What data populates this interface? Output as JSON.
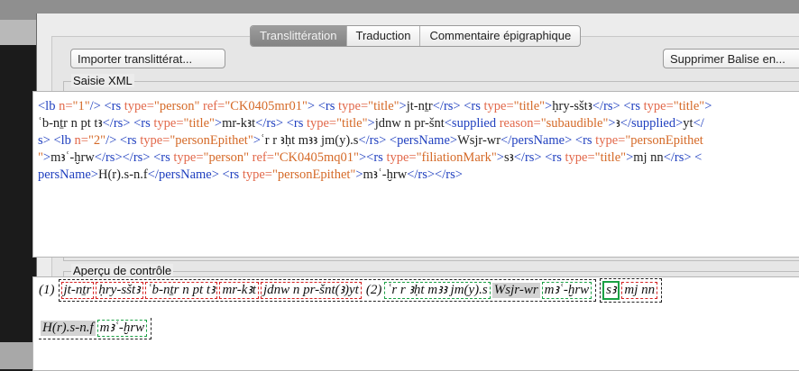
{
  "tabs": [
    {
      "label": "Translittération",
      "active": true
    },
    {
      "label": "Traduction",
      "active": false
    },
    {
      "label": "Commentaire épigraphique",
      "active": false
    }
  ],
  "toolbar": {
    "import_label": "Importer translittérat...",
    "remove_label": "Supprimer Balise en..."
  },
  "xml_group": {
    "label": "Saisie XML"
  },
  "xml_lines": [
    [
      {
        "c": "t",
        "s": "<lb "
      },
      {
        "c": "a",
        "s": "n="
      },
      {
        "c": "v",
        "s": "\"1\""
      },
      {
        "c": "t",
        "s": "/> "
      },
      {
        "c": "t",
        "s": "<rs "
      },
      {
        "c": "a",
        "s": "type="
      },
      {
        "c": "v",
        "s": "\"person\" "
      },
      {
        "c": "a",
        "s": "ref="
      },
      {
        "c": "v",
        "s": "\"CK0405mr01\""
      },
      {
        "c": "t",
        "s": "> "
      },
      {
        "c": "t",
        "s": "<rs "
      },
      {
        "c": "a",
        "s": "type="
      },
      {
        "c": "v",
        "s": "\"title\""
      },
      {
        "c": "t",
        "s": ">"
      },
      {
        "c": "tx",
        "s": "jt-nṯr"
      },
      {
        "c": "t",
        "s": "</rs> "
      },
      {
        "c": "t",
        "s": "<rs "
      },
      {
        "c": "a",
        "s": "type="
      },
      {
        "c": "v",
        "s": "\"title\""
      },
      {
        "c": "t",
        "s": ">"
      },
      {
        "c": "tx",
        "s": "ḥry-sštꜣ"
      },
      {
        "c": "t",
        "s": "</rs> "
      },
      {
        "c": "t",
        "s": "<rs "
      },
      {
        "c": "a",
        "s": "type="
      },
      {
        "c": "v",
        "s": "\"title\""
      },
      {
        "c": "t",
        "s": ">"
      }
    ],
    [
      {
        "c": "tx",
        "s": "ʿb-nṯr n pt tꜣ"
      },
      {
        "c": "t",
        "s": "</rs> "
      },
      {
        "c": "t",
        "s": "<rs "
      },
      {
        "c": "a",
        "s": "type="
      },
      {
        "c": "v",
        "s": "\"title\""
      },
      {
        "c": "t",
        "s": ">"
      },
      {
        "c": "tx",
        "s": "mr-kꜣt"
      },
      {
        "c": "t",
        "s": "</rs> "
      },
      {
        "c": "t",
        "s": "<rs "
      },
      {
        "c": "a",
        "s": "type="
      },
      {
        "c": "v",
        "s": "\"title\""
      },
      {
        "c": "t",
        "s": ">"
      },
      {
        "c": "tx",
        "s": "jdnw n pr-šnt"
      },
      {
        "c": "t",
        "s": "<supplied "
      },
      {
        "c": "a",
        "s": "reason="
      },
      {
        "c": "v",
        "s": "\"subaudible\""
      },
      {
        "c": "t",
        "s": ">"
      },
      {
        "c": "tx",
        "s": "ꜣ"
      },
      {
        "c": "t",
        "s": "</supplied>"
      },
      {
        "c": "tx",
        "s": "yt"
      },
      {
        "c": "t",
        "s": "</"
      }
    ],
    [
      {
        "c": "t",
        "s": "s> "
      },
      {
        "c": "t",
        "s": "<lb "
      },
      {
        "c": "a",
        "s": "n="
      },
      {
        "c": "v",
        "s": "\"2\""
      },
      {
        "c": "t",
        "s": "/> "
      },
      {
        "c": "t",
        "s": "<rs "
      },
      {
        "c": "a",
        "s": "type="
      },
      {
        "c": "v",
        "s": "\"personEpithet\""
      },
      {
        "c": "t",
        "s": ">"
      },
      {
        "c": "tx",
        "s": "ʿr r ꜣḥt mꜣꜣ jm(y).s"
      },
      {
        "c": "t",
        "s": "</rs> "
      },
      {
        "c": "t",
        "s": "<persName>"
      },
      {
        "c": "tx",
        "s": "Wsjr-wr"
      },
      {
        "c": "t",
        "s": "</persName> "
      },
      {
        "c": "t",
        "s": "<rs "
      },
      {
        "c": "a",
        "s": "type="
      },
      {
        "c": "v",
        "s": "\"personEpithet"
      }
    ],
    [
      {
        "c": "v",
        "s": "\""
      },
      {
        "c": "t",
        "s": ">"
      },
      {
        "c": "tx",
        "s": "mꜣʿ-ḫrw"
      },
      {
        "c": "t",
        "s": "</rs></rs> "
      },
      {
        "c": "t",
        "s": "<rs "
      },
      {
        "c": "a",
        "s": "type="
      },
      {
        "c": "v",
        "s": "\"person\" "
      },
      {
        "c": "a",
        "s": "ref="
      },
      {
        "c": "v",
        "s": "\"CK0405mq01\""
      },
      {
        "c": "t",
        "s": ">"
      },
      {
        "c": "t",
        "s": "<rs "
      },
      {
        "c": "a",
        "s": "type="
      },
      {
        "c": "v",
        "s": "\"filiationMark\""
      },
      {
        "c": "t",
        "s": ">"
      },
      {
        "c": "tx",
        "s": "sꜣ"
      },
      {
        "c": "t",
        "s": "</rs> "
      },
      {
        "c": "t",
        "s": "<rs "
      },
      {
        "c": "a",
        "s": "type="
      },
      {
        "c": "v",
        "s": "\"title\""
      },
      {
        "c": "t",
        "s": ">"
      },
      {
        "c": "tx",
        "s": "mj nn"
      },
      {
        "c": "t",
        "s": "</rs> <"
      }
    ],
    [
      {
        "c": "t",
        "s": "persName>"
      },
      {
        "c": "tx",
        "s": "H(r).s-n.f"
      },
      {
        "c": "t",
        "s": "</persName> "
      },
      {
        "c": "t",
        "s": "<rs "
      },
      {
        "c": "a",
        "s": "type="
      },
      {
        "c": "v",
        "s": "\"personEpithet\""
      },
      {
        "c": "t",
        "s": ">"
      },
      {
        "c": "tx",
        "s": "mꜣʿ-ḫrw"
      },
      {
        "c": "t",
        "s": "</rs></rs>"
      }
    ]
  ],
  "preview_group": {
    "label": "Aperçu de contrôle"
  },
  "preview": {
    "line1_num": "(1)",
    "line1_person": [
      "jt-nṯr",
      "ḥry-sštꜣ",
      "ʿb-nṯr n pt tꜣ",
      "mr-kꜣt",
      "jdnw n pr-šnt(ꜣ)yt"
    ],
    "line2_num": "(2)",
    "line2_epithet": "ʿr r ꜣḥt mꜣꜣ jm(y).s",
    "line2_name": "Wsjr-wr",
    "line2_epithet2": "mꜣʿ-ḫrw",
    "line2_filiation": "sꜣ",
    "line2_title": "mj nn",
    "line3_name": "H(r).s-n.f",
    "line3_epithet": "mꜣʿ-ḫrw"
  }
}
